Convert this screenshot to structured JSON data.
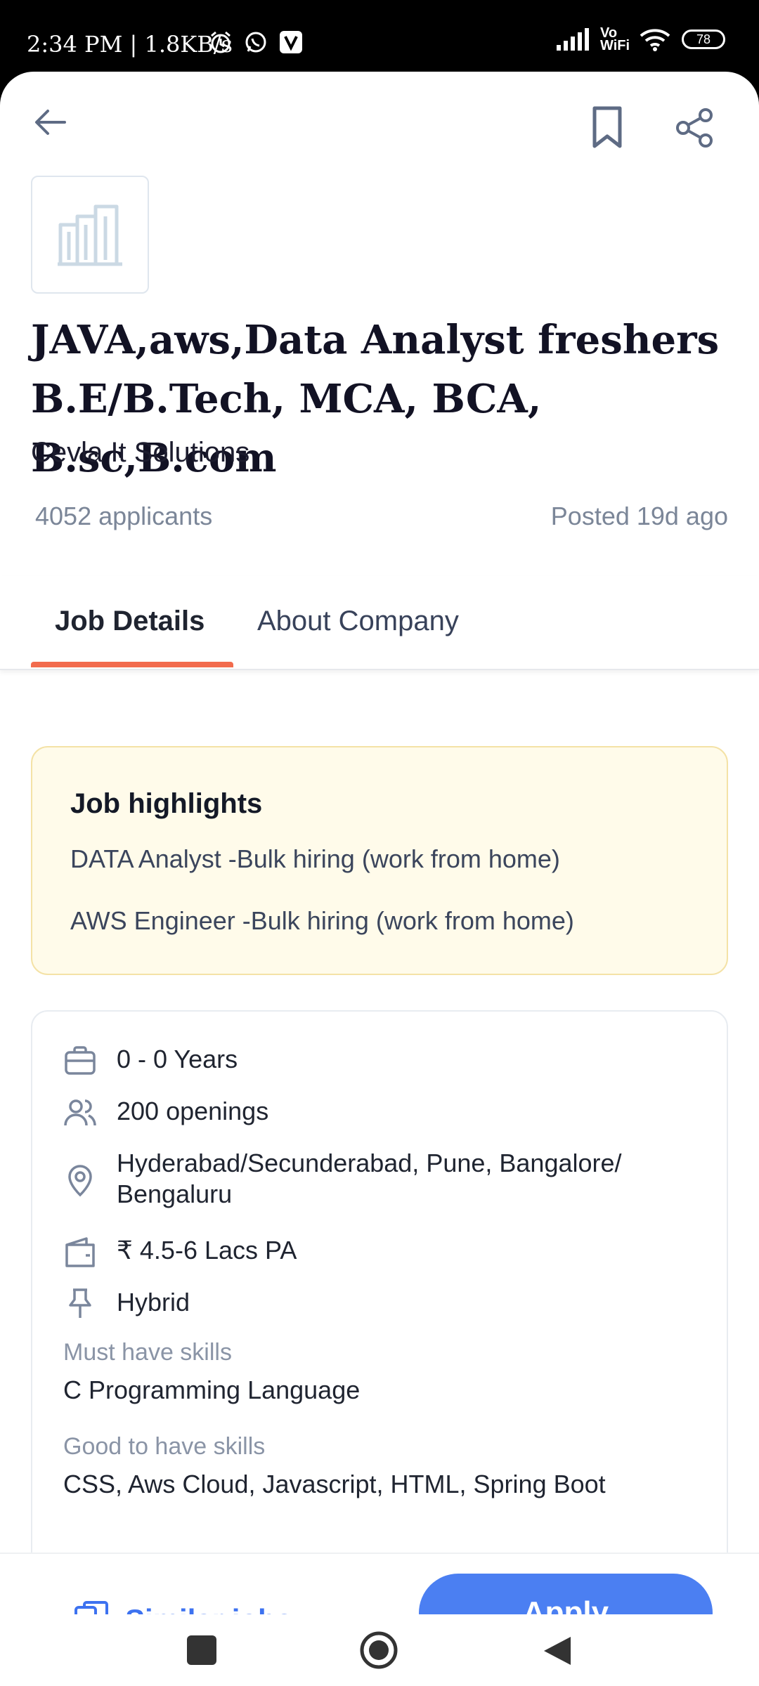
{
  "status_bar": {
    "time": "2:34 PM | 1.8KB/s",
    "battery": "78",
    "network_label": "Vo WiFi"
  },
  "header": {
    "back_icon": "arrow-left-icon",
    "bookmark_icon": "bookmark-icon",
    "share_icon": "share-icon"
  },
  "job": {
    "title": "JAVA,aws,Data Analyst freshers B.E/B.Tech, MCA, BCA, B.sc,B.com",
    "company": "Cevla It Solutions",
    "applicants": "4052 applicants",
    "posted": "Posted 19d ago"
  },
  "tabs": [
    {
      "label": "Job Details",
      "active": true
    },
    {
      "label": "About Company",
      "active": false
    }
  ],
  "highlights": {
    "title": "Job highlights",
    "items": [
      "DATA Analyst -Bulk hiring (work from home)",
      "AWS Engineer -Bulk hiring (work from home)"
    ]
  },
  "details": {
    "experience": "0 - 0 Years",
    "openings": "200 openings",
    "location": "Hyderabad/Secunderabad, Pune, Bangalore/ Bengaluru",
    "salary": "₹ 4.5-6 Lacs PA",
    "work_mode": "Hybrid",
    "must_have_label": "Must have skills",
    "must_have": "C Programming Language",
    "good_to_have_label": "Good to have skills",
    "good_to_have": "CSS, Aws Cloud, Javascript, HTML, Spring Boot"
  },
  "actions": {
    "similar_jobs": "Similar jobs",
    "apply": "Apply"
  },
  "colors": {
    "accent_blue": "#4b7ff2",
    "tab_underline": "#f26b4d",
    "highlight_bg": "#fffbea"
  }
}
